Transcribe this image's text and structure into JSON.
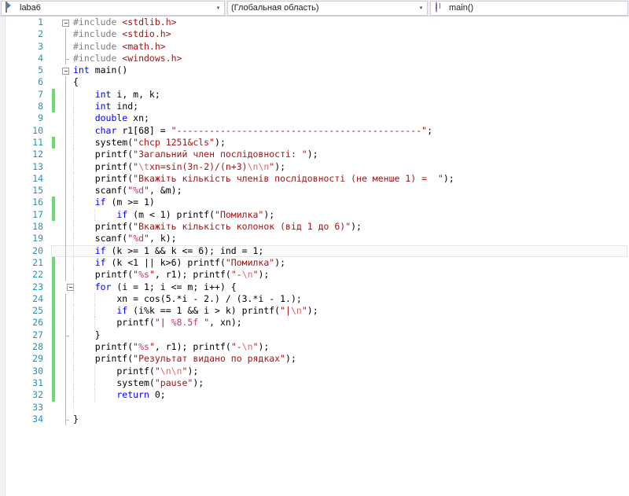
{
  "nav": {
    "project": {
      "label": "laba6",
      "icon": "project-icon",
      "arrow": "▾"
    },
    "scope": {
      "label": "(Глобальная область)",
      "arrow": "▾"
    },
    "member": {
      "label": "main()",
      "icon": "method-icon"
    }
  },
  "editor": {
    "current_line": 20,
    "change_bar_color": "#6ed96e",
    "line_number_color": "#2b91af",
    "lines": [
      {
        "n": 1,
        "fold": "open",
        "indent": 0,
        "tokens": [
          {
            "t": "pp",
            "v": "#include "
          },
          {
            "t": "str",
            "v": "<stdlib.h>"
          }
        ]
      },
      {
        "n": 2,
        "fold": "body",
        "indent": 0,
        "tokens": [
          {
            "t": "pp",
            "v": "#include "
          },
          {
            "t": "str",
            "v": "<stdio.h>"
          }
        ]
      },
      {
        "n": 3,
        "fold": "body",
        "indent": 0,
        "tokens": [
          {
            "t": "pp",
            "v": "#include "
          },
          {
            "t": "str",
            "v": "<math.h>"
          }
        ]
      },
      {
        "n": 4,
        "fold": "end",
        "indent": 0,
        "tokens": [
          {
            "t": "pp",
            "v": "#include "
          },
          {
            "t": "str",
            "v": "<windows.h>"
          }
        ]
      },
      {
        "n": 5,
        "fold": "open",
        "indent": 0,
        "tokens": [
          {
            "t": "kw",
            "v": "int"
          },
          {
            "t": "id",
            "v": " main()"
          }
        ]
      },
      {
        "n": 6,
        "fold": "body",
        "indent": 0,
        "tokens": [
          {
            "t": "punct",
            "v": "{"
          }
        ]
      },
      {
        "n": 7,
        "fold": "body",
        "change": true,
        "indent": 1,
        "tokens": [
          {
            "t": "kw",
            "v": "    int"
          },
          {
            "t": "id",
            "v": " i, m, k;"
          }
        ]
      },
      {
        "n": 8,
        "fold": "body",
        "change": true,
        "indent": 1,
        "tokens": [
          {
            "t": "kw",
            "v": "    int"
          },
          {
            "t": "id",
            "v": " ind;"
          }
        ]
      },
      {
        "n": 9,
        "fold": "body",
        "indent": 1,
        "tokens": [
          {
            "t": "kw",
            "v": "    double"
          },
          {
            "t": "id",
            "v": " xn;"
          }
        ]
      },
      {
        "n": 10,
        "fold": "body",
        "indent": 1,
        "tokens": [
          {
            "t": "kw",
            "v": "    char"
          },
          {
            "t": "id",
            "v": " r1[68] = "
          },
          {
            "t": "str",
            "v": "\"---------------------------------------------\""
          },
          {
            "t": "punct",
            "v": ";"
          }
        ]
      },
      {
        "n": 11,
        "fold": "body",
        "change": true,
        "indent": 1,
        "tokens": [
          {
            "t": "id",
            "v": "    system("
          },
          {
            "t": "str",
            "v": "\"chcp 1251&cls\""
          },
          {
            "t": "id",
            "v": ");"
          }
        ]
      },
      {
        "n": 12,
        "fold": "body",
        "indent": 1,
        "tokens": [
          {
            "t": "id",
            "v": "    printf("
          },
          {
            "t": "str",
            "v": "\"Загальний член послідовності: \""
          },
          {
            "t": "id",
            "v": ");"
          }
        ]
      },
      {
        "n": 13,
        "fold": "body",
        "indent": 1,
        "tokens": [
          {
            "t": "id",
            "v": "    printf("
          },
          {
            "t": "str",
            "v": "\""
          },
          {
            "t": "esc",
            "v": "\\t"
          },
          {
            "t": "str",
            "v": "xn=sin(3n-2)/(n+3)"
          },
          {
            "t": "esc",
            "v": "\\n\\n"
          },
          {
            "t": "str",
            "v": "\""
          },
          {
            "t": "id",
            "v": ");"
          }
        ]
      },
      {
        "n": 14,
        "fold": "body",
        "indent": 1,
        "tokens": [
          {
            "t": "id",
            "v": "    printf("
          },
          {
            "t": "str",
            "v": "\"Вкажіть кількість членів послідовності (не менше 1) =  \""
          },
          {
            "t": "id",
            "v": ");"
          }
        ]
      },
      {
        "n": 15,
        "fold": "body",
        "indent": 1,
        "tokens": [
          {
            "t": "id",
            "v": "    scanf("
          },
          {
            "t": "str",
            "v": "\""
          },
          {
            "t": "fmt",
            "v": "%d"
          },
          {
            "t": "str",
            "v": "\""
          },
          {
            "t": "id",
            "v": ", &m);"
          }
        ]
      },
      {
        "n": 16,
        "fold": "body",
        "change": true,
        "indent": 1,
        "tokens": [
          {
            "t": "kw",
            "v": "    if"
          },
          {
            "t": "id",
            "v": " (m >= 1)"
          }
        ]
      },
      {
        "n": 17,
        "fold": "body",
        "change": true,
        "indent": 2,
        "tokens": [
          {
            "t": "kw",
            "v": "        if"
          },
          {
            "t": "id",
            "v": " (m < 1) printf("
          },
          {
            "t": "str",
            "v": "\"Помилка\""
          },
          {
            "t": "id",
            "v": ");"
          }
        ]
      },
      {
        "n": 18,
        "fold": "body",
        "indent": 1,
        "tokens": [
          {
            "t": "id",
            "v": "    printf("
          },
          {
            "t": "str",
            "v": "\"Вкажіть кількість колонок (від 1 до 6)\""
          },
          {
            "t": "id",
            "v": ");"
          }
        ]
      },
      {
        "n": 19,
        "fold": "body",
        "indent": 1,
        "tokens": [
          {
            "t": "id",
            "v": "    scanf("
          },
          {
            "t": "str",
            "v": "\""
          },
          {
            "t": "fmt",
            "v": "%d"
          },
          {
            "t": "str",
            "v": "\""
          },
          {
            "t": "id",
            "v": ", k);"
          }
        ]
      },
      {
        "n": 20,
        "fold": "body",
        "indent": 1,
        "current": true,
        "tokens": [
          {
            "t": "kw",
            "v": "    if"
          },
          {
            "t": "id",
            "v": " (k >= 1 && k <= 6); ind = 1;"
          }
        ]
      },
      {
        "n": 21,
        "fold": "body",
        "change": true,
        "indent": 1,
        "tokens": [
          {
            "t": "kw",
            "v": "    if"
          },
          {
            "t": "id",
            "v": " (k <1 || k>6) printf("
          },
          {
            "t": "str",
            "v": "\"Помилка\""
          },
          {
            "t": "id",
            "v": ");"
          }
        ]
      },
      {
        "n": 22,
        "fold": "body",
        "change": true,
        "indent": 1,
        "tokens": [
          {
            "t": "id",
            "v": "    printf("
          },
          {
            "t": "str",
            "v": "\""
          },
          {
            "t": "fmt",
            "v": "%s"
          },
          {
            "t": "str",
            "v": "\""
          },
          {
            "t": "id",
            "v": ", r1); printf("
          },
          {
            "t": "str",
            "v": "\"-"
          },
          {
            "t": "esc",
            "v": "\\n"
          },
          {
            "t": "str",
            "v": "\""
          },
          {
            "t": "id",
            "v": ");"
          }
        ]
      },
      {
        "n": 23,
        "fold": "open2",
        "change": true,
        "indent": 1,
        "tokens": [
          {
            "t": "kw",
            "v": "    for"
          },
          {
            "t": "id",
            "v": " (i = 1; i <= m; i++) {"
          }
        ]
      },
      {
        "n": 24,
        "fold": "body",
        "change": true,
        "indent": 2,
        "tokens": [
          {
            "t": "id",
            "v": "        xn = cos(5.*i - 2.) / (3.*i - 1.);"
          }
        ]
      },
      {
        "n": 25,
        "fold": "body",
        "change": true,
        "indent": 2,
        "tokens": [
          {
            "t": "kw",
            "v": "        if"
          },
          {
            "t": "id",
            "v": " (i%k == 1 && i > k) printf("
          },
          {
            "t": "str",
            "v": "\"|"
          },
          {
            "t": "esc",
            "v": "\\n"
          },
          {
            "t": "str",
            "v": "\""
          },
          {
            "t": "id",
            "v": ");"
          }
        ]
      },
      {
        "n": 26,
        "fold": "body",
        "change": true,
        "indent": 2,
        "tokens": [
          {
            "t": "id",
            "v": "        printf("
          },
          {
            "t": "str",
            "v": "\"| "
          },
          {
            "t": "fmt",
            "v": "%8.5f"
          },
          {
            "t": "str",
            "v": " \""
          },
          {
            "t": "id",
            "v": ", xn);"
          }
        ]
      },
      {
        "n": 27,
        "fold": "endin",
        "change": true,
        "indent": 1,
        "tokens": [
          {
            "t": "punct",
            "v": "    }"
          }
        ]
      },
      {
        "n": 28,
        "fold": "body",
        "change": true,
        "indent": 1,
        "tokens": [
          {
            "t": "id",
            "v": "    printf("
          },
          {
            "t": "str",
            "v": "\""
          },
          {
            "t": "fmt",
            "v": "%s"
          },
          {
            "t": "str",
            "v": "\""
          },
          {
            "t": "id",
            "v": ", r1); printf("
          },
          {
            "t": "str",
            "v": "\"-"
          },
          {
            "t": "esc",
            "v": "\\n"
          },
          {
            "t": "str",
            "v": "\""
          },
          {
            "t": "id",
            "v": ");"
          }
        ]
      },
      {
        "n": 29,
        "fold": "body",
        "change": true,
        "indent": 1,
        "tokens": [
          {
            "t": "id",
            "v": "    printf("
          },
          {
            "t": "str",
            "v": "\"Результат видано по рядках\""
          },
          {
            "t": "id",
            "v": ");"
          }
        ]
      },
      {
        "n": 30,
        "fold": "body",
        "change": true,
        "indent": 2,
        "tokens": [
          {
            "t": "id",
            "v": "        printf("
          },
          {
            "t": "str",
            "v": "\""
          },
          {
            "t": "esc",
            "v": "\\n\\n"
          },
          {
            "t": "str",
            "v": "\""
          },
          {
            "t": "id",
            "v": ");"
          }
        ]
      },
      {
        "n": 31,
        "fold": "body",
        "change": true,
        "indent": 2,
        "tokens": [
          {
            "t": "id",
            "v": "        system("
          },
          {
            "t": "str",
            "v": "\"pause\""
          },
          {
            "t": "id",
            "v": ");"
          }
        ]
      },
      {
        "n": 32,
        "fold": "body",
        "change": true,
        "indent": 2,
        "tokens": [
          {
            "t": "kw",
            "v": "        return"
          },
          {
            "t": "num",
            "v": " 0"
          },
          {
            "t": "punct",
            "v": ";"
          }
        ]
      },
      {
        "n": 33,
        "fold": "body",
        "indent": 1,
        "tokens": []
      },
      {
        "n": 34,
        "fold": "end",
        "indent": 0,
        "tokens": [
          {
            "t": "punct",
            "v": "}"
          }
        ]
      }
    ]
  }
}
